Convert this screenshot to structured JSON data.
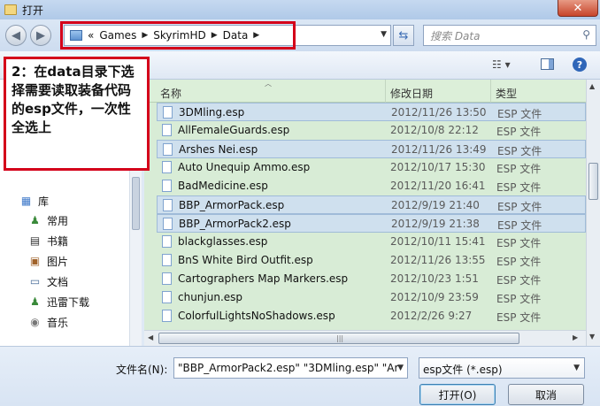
{
  "window": {
    "title": "打开",
    "close_label": "✕"
  },
  "address": {
    "prefix": "«",
    "crumbs": [
      "Games",
      "SkyrimHD",
      "Data"
    ],
    "sep": "▶",
    "dropdown": "▼"
  },
  "search": {
    "placeholder": "搜索 Data"
  },
  "annotation": {
    "text": "2：在data目录下选择需要读取装备代码的esp文件，一次性全选上"
  },
  "nav_pane": {
    "items": [
      {
        "label": "库",
        "icon": "library-icon"
      },
      {
        "label": "常用",
        "icon": "user-icon"
      },
      {
        "label": "书籍",
        "icon": "film-icon"
      },
      {
        "label": "图片",
        "icon": "picture-icon"
      },
      {
        "label": "文档",
        "icon": "document-icon"
      },
      {
        "label": "迅雷下载",
        "icon": "user-icon"
      },
      {
        "label": "音乐",
        "icon": "music-icon"
      }
    ]
  },
  "file_list": {
    "columns": {
      "name": "名称",
      "date": "修改日期",
      "type": "类型"
    },
    "rows": [
      {
        "name": "3DMling.esp",
        "date": "2012/11/26 13:50",
        "type": "ESP 文件",
        "selected": true
      },
      {
        "name": "AllFemaleGuards.esp",
        "date": "2012/10/8 22:12",
        "type": "ESP 文件",
        "selected": false
      },
      {
        "name": "Arshes Nei.esp",
        "date": "2012/11/26 13:49",
        "type": "ESP 文件",
        "selected": true
      },
      {
        "name": "Auto Unequip Ammo.esp",
        "date": "2012/10/17 15:30",
        "type": "ESP 文件",
        "selected": false
      },
      {
        "name": "BadMedicine.esp",
        "date": "2012/11/20 16:41",
        "type": "ESP 文件",
        "selected": false
      },
      {
        "name": "BBP_ArmorPack.esp",
        "date": "2012/9/19 21:40",
        "type": "ESP 文件",
        "selected": true
      },
      {
        "name": "BBP_ArmorPack2.esp",
        "date": "2012/9/19 21:38",
        "type": "ESP 文件",
        "selected": true
      },
      {
        "name": "blackglasses.esp",
        "date": "2012/10/11 15:41",
        "type": "ESP 文件",
        "selected": false
      },
      {
        "name": "BnS White Bird Outfit.esp",
        "date": "2012/11/26 13:55",
        "type": "ESP 文件",
        "selected": false
      },
      {
        "name": "Cartographers Map Markers.esp",
        "date": "2012/10/23 1:51",
        "type": "ESP 文件",
        "selected": false
      },
      {
        "name": "chunjun.esp",
        "date": "2012/10/9 23:59",
        "type": "ESP 文件",
        "selected": false
      },
      {
        "name": "ColorfulLightsNoShadows.esp",
        "date": "2012/2/26 9:27",
        "type": "ESP 文件",
        "selected": false
      }
    ]
  },
  "bottom": {
    "filename_label": "文件名(N):",
    "filename_value": "\"BBP_ArmorPack2.esp\" \"3DMling.esp\" \"Ar",
    "filetype_value": "esp文件 (*.esp)",
    "open_label": "打开(O)",
    "cancel_label": "取消"
  },
  "colors": {
    "highlight_red": "#d4001a",
    "list_bg": "#d8ecd6",
    "selection": "#cfe0ee"
  }
}
